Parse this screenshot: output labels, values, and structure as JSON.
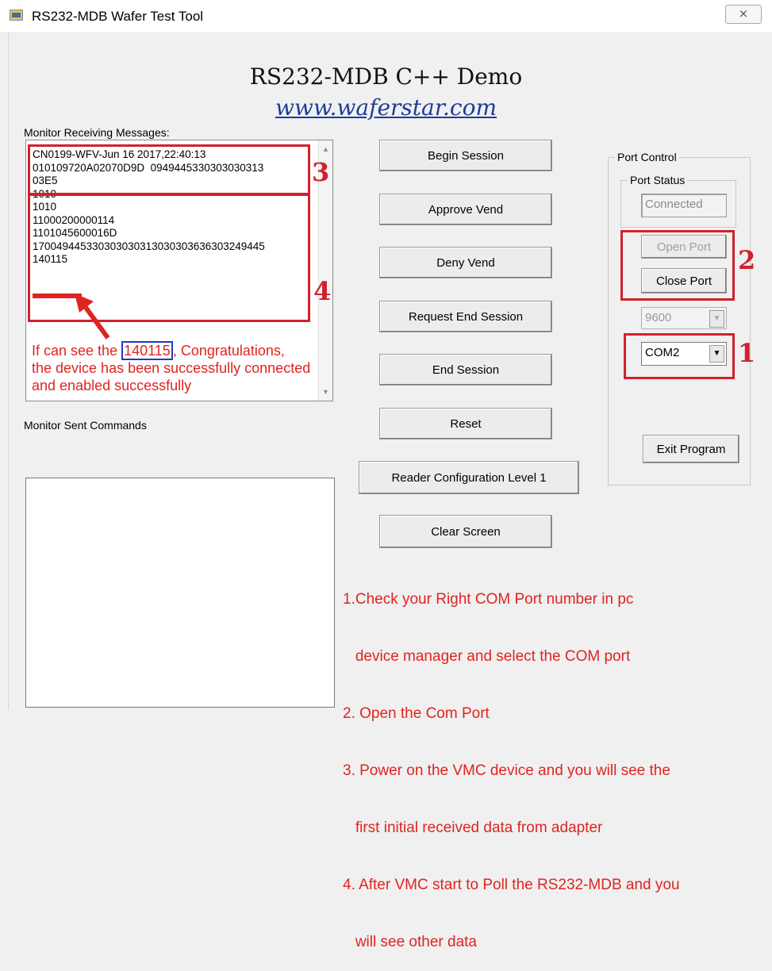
{
  "window": {
    "title": "RS232-MDB Wafer Test Tool",
    "close_glyph": "⨯",
    "heading": "RS232-MDB C++ Demo",
    "website": "www.waferstar.com"
  },
  "receive": {
    "label": "Monitor Receiving Messages:",
    "lines": "CN0199-WFV-Jun 16 2017,22:40:13\n010109720A02070D9D  0949445330303030313\n03E5\n1010\n1010\n11000200000114\n1101045600016D\n17004944533030303031303030363630324944​5\n140115"
  },
  "sent": {
    "label": "Monitor Sent Commands"
  },
  "buttons": {
    "begin_session": "Begin Session",
    "approve_vend": "Approve Vend",
    "deny_vend": "Deny Vend",
    "request_end_session": "Request End Session",
    "end_session": "End Session",
    "reset": "Reset",
    "reader_config": "Reader Configuration Level 1",
    "clear_screen": "Clear Screen",
    "open_port": "Open Port",
    "close_port": "Close Port",
    "exit_program": "Exit Program"
  },
  "port": {
    "group_label": "Port Control",
    "status_label": "Port Status",
    "status_value": "Connected",
    "baud": "9600",
    "com": "COM2"
  },
  "annotations": {
    "markers": {
      "one": "1",
      "two": "2",
      "three": "3",
      "four": "4"
    },
    "note_prefix": "If can see the ",
    "note_highlight": "140115",
    "note_suffix": ", Congratulations,",
    "note_line2": "the device has been successfully connected",
    "note_line3": "and enabled successfully",
    "steps": [
      "1.Check your Right COM Port number in pc",
      "   device manager and select the COM port",
      "2. Open the Com Port",
      "3. Power on the VMC device and you will see the",
      "   first initial received data from adapter",
      "4. After VMC start to Poll the RS232-MDB and you",
      "   will see other data"
    ]
  },
  "colors": {
    "annotation_red": "#e0241f",
    "highlight_blue": "#1f3bc7",
    "link_blue": "#1d3d9a"
  }
}
